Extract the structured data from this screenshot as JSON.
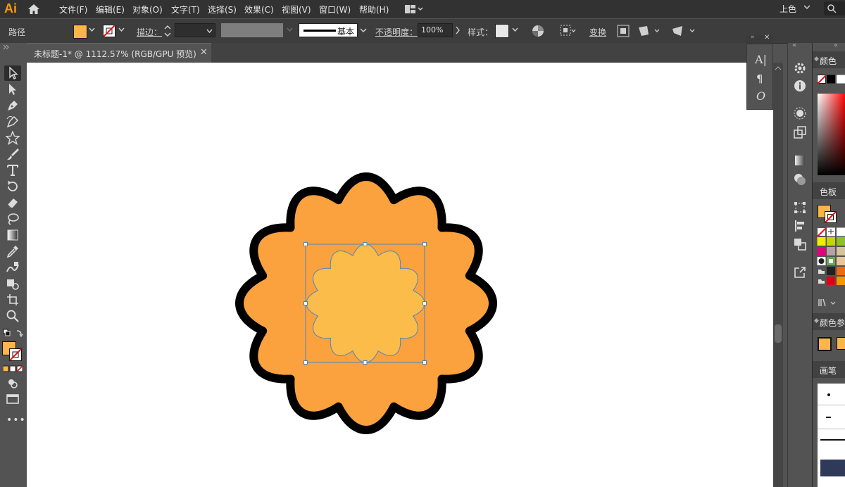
{
  "app": {
    "logo": "Ai"
  },
  "menu": {
    "items": [
      "文件(F)",
      "编辑(E)",
      "对象(O)",
      "文字(T)",
      "选择(S)",
      "效果(C)",
      "视图(V)",
      "窗口(W)",
      "帮助(H)"
    ],
    "workspace": "上色"
  },
  "control": {
    "selection_type": "路径",
    "stroke_label": "描边：",
    "brush_label": "基本",
    "opacity_label": "不透明度：",
    "opacity_value": "100%",
    "style_label": "样式：",
    "transform_label": "变换"
  },
  "tab": {
    "title": "未标题-1* @ 1112.57% (RGB/GPU 预览)",
    "close": "✕"
  },
  "right": {
    "color_panel": "颜色",
    "swatches_panel": "色板",
    "color_guide_panel": "颜色参",
    "brushes_panel": "画笔"
  },
  "colors": {
    "fill": "#fbb54a",
    "outer_shape": "#fba23e",
    "inner_shape": "#fbbc4a",
    "outline": "#000000",
    "selection": "#4a86c5"
  }
}
